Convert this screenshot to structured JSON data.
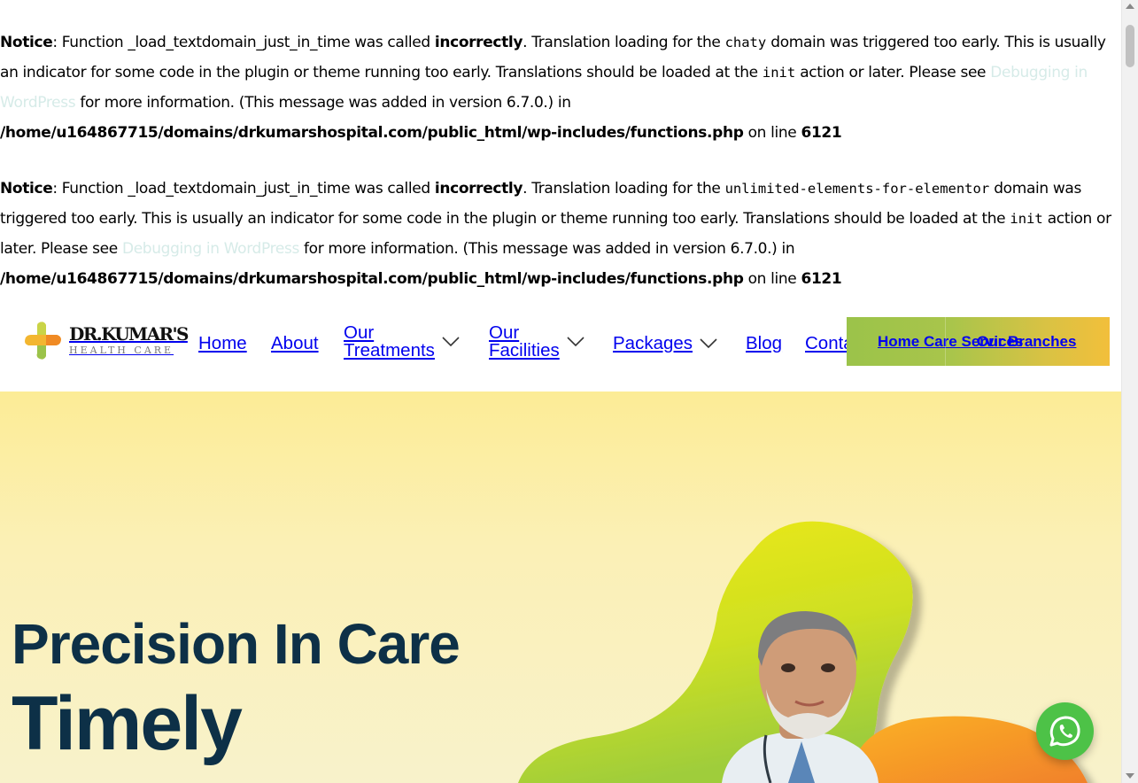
{
  "notices": [
    {
      "label": "Notice",
      "text1": ": Function _load_textdomain_just_in_time was called ",
      "bold_word": "incorrectly",
      "text2": ". Translation loading for the ",
      "domain": "chaty",
      "text3": " domain was triggered too early. This is usually an indicator for some code in the plugin or theme running too early. Translations should be loaded at the ",
      "action": "init",
      "text4": " action or later. Please see ",
      "link_text": "Debugging in WordPress",
      "text5": " for more information. (This message was added in version 6.7.0.) in",
      "path": "/home/u164867715/domains/drkumarshospital.com/public_html/wp-includes/functions.php",
      "line_text": " on line ",
      "line_number": "6121"
    },
    {
      "label": "Notice",
      "text1": ": Function _load_textdomain_just_in_time was called ",
      "bold_word": "incorrectly",
      "text2": ". Translation loading for the ",
      "domain": "unlimited-elements-for-elementor",
      "text3": " domain was triggered too early. This is usually an indicator for some code in the plugin or theme running too early. Translations should be loaded at the ",
      "action": "init",
      "text4": " action or later. Please see ",
      "link_text": "Debugging in WordPress",
      "text5": " for more information. (This message was added in version 6.7.0.) in",
      "path": "/home/u164867715/domains/drkumarshospital.com/public_html/wp-includes/functions.php",
      "line_text": " on line ",
      "line_number": "6121"
    }
  ],
  "logo": {
    "name": "DR.KUMAR'S",
    "sub": "HEALTH CARE"
  },
  "nav": {
    "home": "Home",
    "about": "About",
    "treatments_line1": "Our",
    "treatments_line2": "Treatments",
    "facilities_line1": "Our",
    "facilities_line2": "Facilities",
    "packages": "Packages",
    "blog": "Blog",
    "contact": "Contact"
  },
  "cta": {
    "home_care": "Home Care Services",
    "branches": "Our Branches"
  },
  "hero": {
    "line1": "Precision In Care",
    "line2": "Timely"
  },
  "colors": {
    "heading": "#0d3047",
    "accent_green": "#9bc34a",
    "accent_yellow": "#f2bf3b",
    "whatsapp": "#4dc247",
    "link": "#d6ebe8"
  },
  "icons": {
    "whatsapp": "whatsapp-icon",
    "chevron": "chevron-down-icon"
  }
}
